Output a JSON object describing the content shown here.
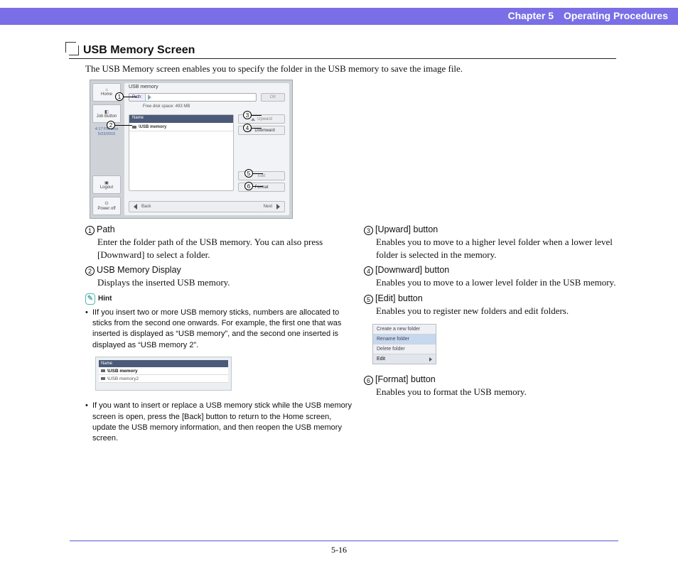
{
  "header": {
    "chapter": "Chapter 5",
    "title": "Operating Procedures"
  },
  "section": {
    "title": "USB Memory Screen",
    "intro": "The USB Memory screen enables you to specify the folder in the USB memory to save the image file."
  },
  "fig1": {
    "sidebar": {
      "home": "Home",
      "job": "Job Button",
      "time1": "4:17 PM  Mos",
      "time2": "5/23/2015",
      "logout": "Logout",
      "power": "Power off"
    },
    "panel_title": "USB memory",
    "path_label": "Path:",
    "ok": "OK",
    "free": "Free disk space:     493  MB",
    "list_hdr": "Name",
    "list_row1": "\\USB memory",
    "upward": "Upward",
    "downward": "Downward",
    "edit": "Edit",
    "format": "Format",
    "back": "Back",
    "next": "Next"
  },
  "callouts": {
    "c1": "1",
    "c2": "2",
    "c3": "3",
    "c4": "4",
    "c5": "5",
    "c6": "6"
  },
  "left": {
    "i1_t": "Path",
    "i1_b": "Enter the folder path of the USB memory. You can also press [Downward] to select a folder.",
    "i2_t": "USB Memory Display",
    "i2_b": "Displays the inserted USB memory.",
    "hint": "Hint",
    "b1": "IIf you insert two or more USB memory sticks, numbers are allocated to sticks from the second one onwards. For example, the first one that was inserted is displayed as “USB memory”, and the second one inserted is displayed as “USB memory 2”.",
    "fig2_hdr": "Name",
    "fig2_r1": "\\USB memory",
    "fig2_r2": "\\USB memory2",
    "b2": "If you want to insert or replace a USB memory stick while the USB memory screen is open, press the [Back] button to return to the Home screen, update the USB memory information, and then reopen the USB memory screen."
  },
  "right": {
    "i3_t": "[Upward] button",
    "i3_b": "Enables you to move to a higher level folder when a lower level folder is selected in the memory.",
    "i4_t": "[Downward] button",
    "i4_b": "Enables you to move to a lower level folder in the USB memory.",
    "i5_t": "[Edit] button",
    "i5_b": "Enables you to register new folders and edit folders.",
    "fig3_m1": "Create a new folder",
    "fig3_m2": "Rename folder",
    "fig3_m3": "Delete folder",
    "fig3_ed": "Edit",
    "i6_t": "[Format] button",
    "i6_b": "Enables you to format the USB memory."
  },
  "footer": {
    "page": "5-16"
  }
}
